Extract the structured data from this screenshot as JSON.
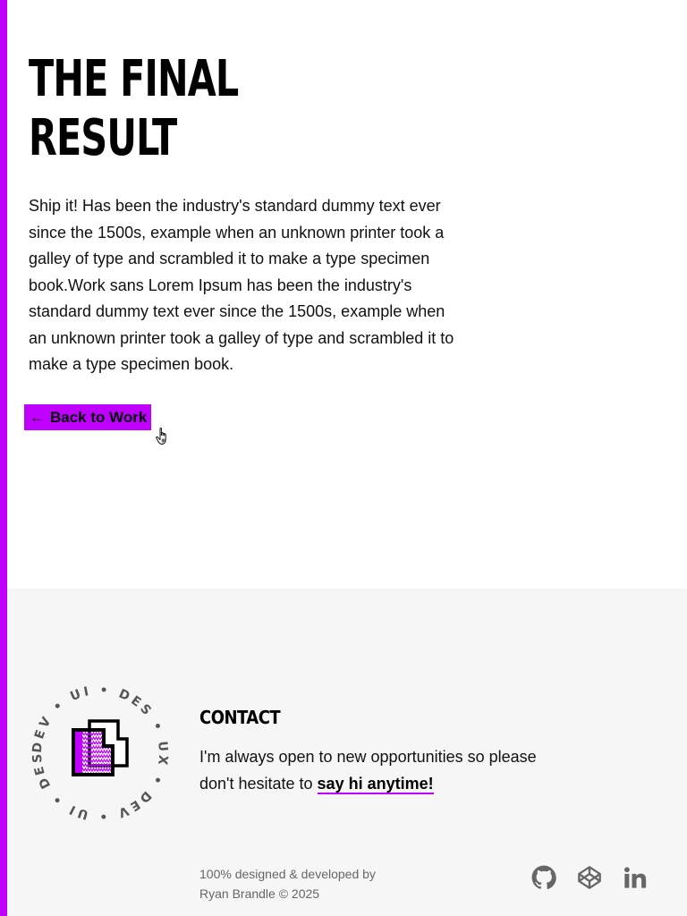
{
  "accent_color": "#c000ff",
  "main": {
    "title_line1": "THE FINAL",
    "title_line2": "RESULT",
    "body": "Ship it! Has been the industry's standard dummy text ever since the 1500s, example when an unknown printer took a galley of type and scrambled it to make a type specimen book.Work sans Lorem Ipsum has been the industry's standard dummy text ever since the 1500s, example when an unknown printer took a galley of type and scrambled it to make a type specimen book.",
    "back_button": {
      "arrow": "←",
      "label": "Back to Work"
    }
  },
  "footer": {
    "badge_text": "DEV • UI • DES • UX • DEV • UI • DES • UX •",
    "contact_title": "CONTACT",
    "contact_text": "I'm always open to new opportunities so please don't hesitate to",
    "contact_link": "say hi anytime!",
    "credits_line1": "100% designed & developed by",
    "credits_line2": "Ryan Brandle © 2025",
    "social": [
      {
        "name": "github",
        "icon": "github-icon"
      },
      {
        "name": "codepen",
        "icon": "codepen-icon"
      },
      {
        "name": "linkedin",
        "icon": "linkedin-icon"
      }
    ]
  }
}
